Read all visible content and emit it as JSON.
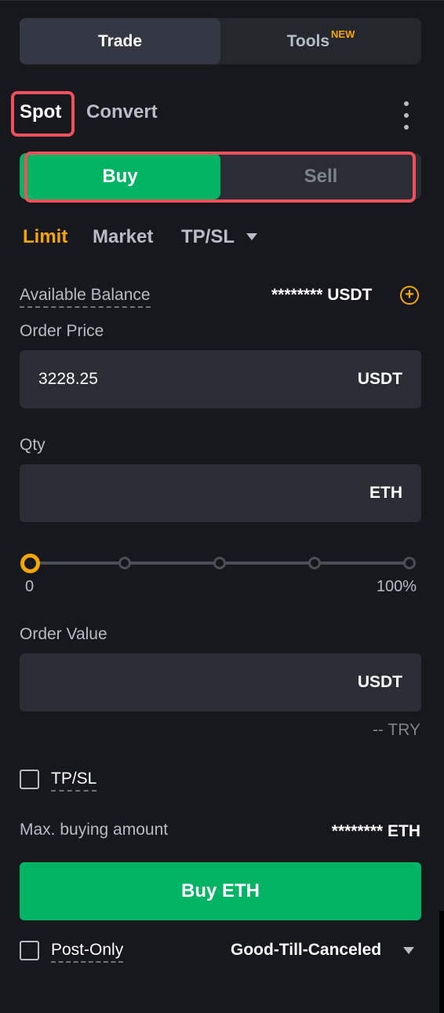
{
  "top_tabs": {
    "trade": "Trade",
    "tools": "Tools",
    "tools_badge": "NEW"
  },
  "mode_tabs": {
    "spot": "Spot",
    "convert": "Convert"
  },
  "side_tabs": {
    "buy": "Buy",
    "sell": "Sell"
  },
  "order_types": {
    "limit": "Limit",
    "market": "Market",
    "tpsl": "TP/SL"
  },
  "balance": {
    "label": "Available Balance",
    "value": "******** USDT"
  },
  "order_price": {
    "label": "Order Price",
    "value": "3228.25",
    "unit": "USDT"
  },
  "qty": {
    "label": "Qty",
    "value": "",
    "unit": "ETH"
  },
  "slider": {
    "min_label": "0",
    "max_label": "100%",
    "value_percent": 0
  },
  "order_value": {
    "label": "Order Value",
    "value": "",
    "unit": "USDT",
    "converted": "-- TRY"
  },
  "tpsl_checkbox": {
    "label": "TP/SL",
    "checked": false
  },
  "max_buy": {
    "label": "Max. buying amount",
    "value": "******** ETH"
  },
  "submit": {
    "label": "Buy ETH"
  },
  "post_only": {
    "label": "Post-Only",
    "checked": false
  },
  "time_in_force": {
    "selected": "Good-Till-Canceled"
  },
  "colors": {
    "background": "#17181e",
    "buy_green": "#00b464",
    "accent_orange": "#f7a600",
    "highlight_red": "#f0505a"
  }
}
